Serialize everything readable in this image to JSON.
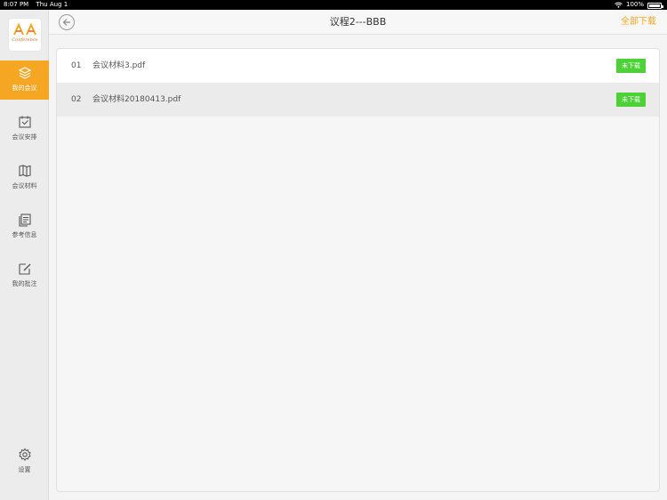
{
  "status_bar": {
    "time": "8:07 PM",
    "date": "Thu Aug 1",
    "battery": "100%"
  },
  "sidebar": {
    "logo_text": "Conference",
    "items": [
      {
        "label": "我的会议",
        "icon": "layers-icon",
        "active": true
      },
      {
        "label": "会议安排",
        "icon": "calendar-icon",
        "active": false
      },
      {
        "label": "会议材料",
        "icon": "map-book-icon",
        "active": false
      },
      {
        "label": "参考信息",
        "icon": "documents-icon",
        "active": false
      },
      {
        "label": "我的批注",
        "icon": "edit-note-icon",
        "active": false
      }
    ],
    "settings_label": "设置"
  },
  "header": {
    "title": "议程2---BBB",
    "download_all": "全部下载"
  },
  "files": [
    {
      "index": "01",
      "name": "会议材料3.pdf",
      "status": "未下载"
    },
    {
      "index": "02",
      "name": "会议材料20180413.pdf",
      "status": "未下载"
    }
  ],
  "colors": {
    "accent": "#f5a623",
    "badge": "#4cd137"
  }
}
